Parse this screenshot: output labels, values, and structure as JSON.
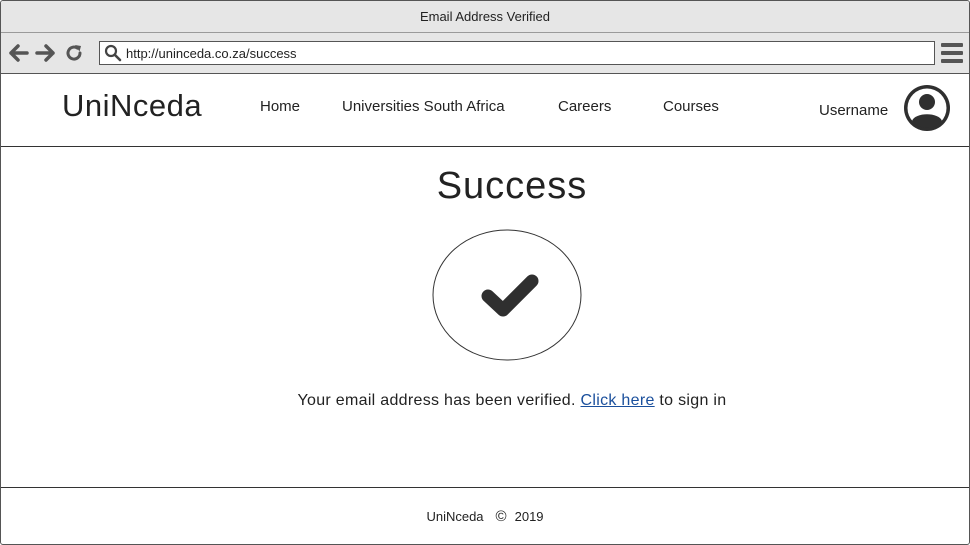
{
  "window": {
    "title": "Email Address Verified"
  },
  "browser": {
    "url": "http://uninceda.co.za/success",
    "back_icon": "arrow-left-icon",
    "forward_icon": "arrow-right-icon",
    "refresh_icon": "refresh-icon",
    "search_icon": "search-icon",
    "menu_icon": "hamburger-menu-icon"
  },
  "header": {
    "logo": "UniNceda",
    "nav": [
      {
        "label": "Home"
      },
      {
        "label": "Universities South Africa"
      },
      {
        "label": "Careers"
      },
      {
        "label": "Courses"
      }
    ],
    "username": "Username",
    "avatar_icon": "user-avatar-icon"
  },
  "main": {
    "title": "Success",
    "status_icon": "checkmark-icon",
    "message_before": "Your email address has been verified.",
    "link_text": "Click here",
    "message_after": "to sign in"
  },
  "footer": {
    "brand": "UniNceda",
    "copyright_symbol": "©",
    "year": "2019"
  },
  "colors": {
    "link": "#1a4f9c",
    "chrome": "#e6e6e6",
    "text": "#222222"
  }
}
